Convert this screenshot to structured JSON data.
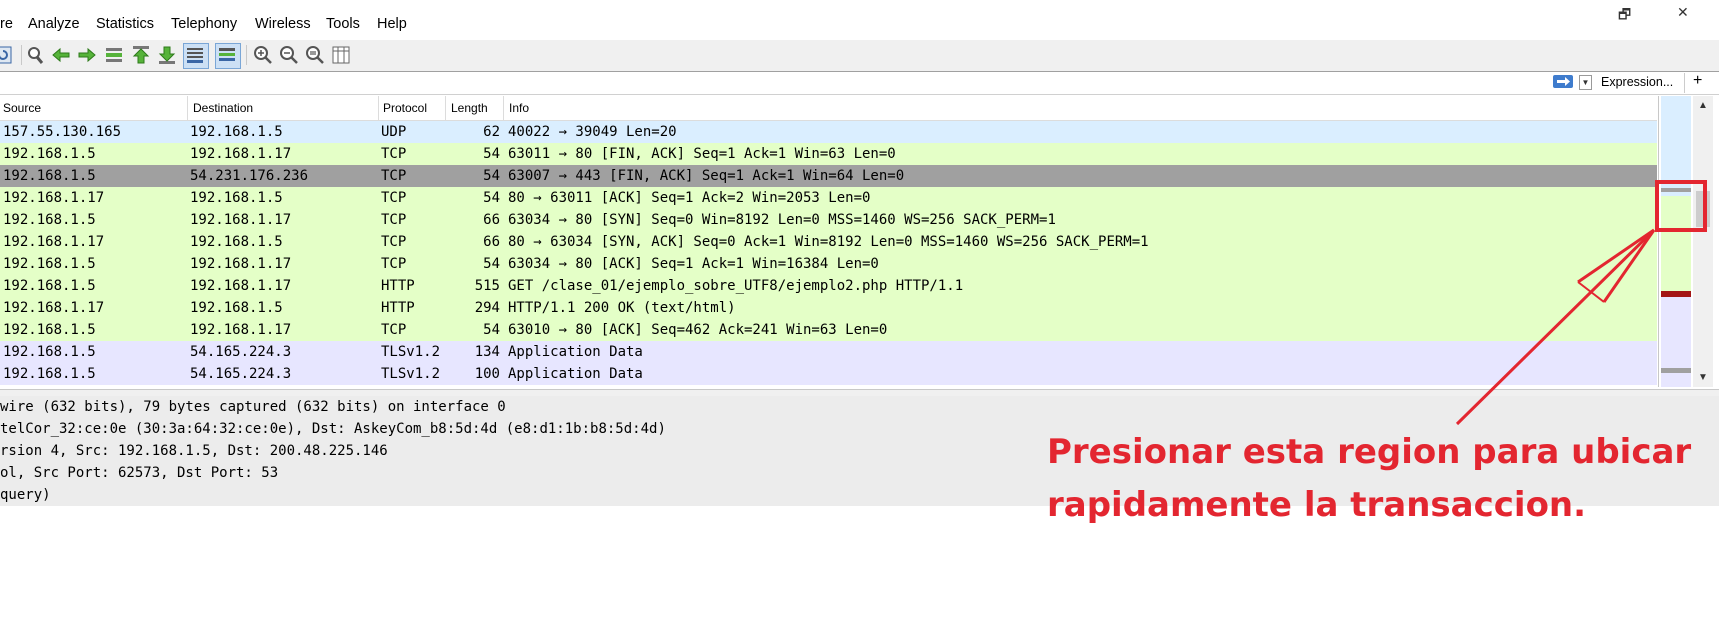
{
  "menu": {
    "items": [
      "re",
      "Analyze",
      "Statistics",
      "Telephony",
      "Wireless",
      "Tools",
      "Help"
    ]
  },
  "window_controls": {
    "restore": "🗗",
    "close": "✕"
  },
  "toolbar": {
    "icons": [
      "reload-icon",
      "find-icon",
      "go-back-icon",
      "go-forward-icon",
      "go-to-packet-icon",
      "first-packet-icon",
      "last-packet-icon",
      "autoscroll-icon",
      "colorize-icon",
      "zoom-in-icon",
      "zoom-out-icon",
      "normal-size-icon",
      "resize-columns-icon"
    ]
  },
  "filter": {
    "expression_label": "Expression...",
    "add_label": "+"
  },
  "packet_list": {
    "columns": {
      "source": "Source",
      "destination": "Destination",
      "protocol": "Protocol",
      "length": "Length",
      "info": "Info"
    },
    "rows": [
      {
        "source": "157.55.130.165",
        "destination": "192.168.1.5",
        "protocol": "UDP",
        "length": "62",
        "info": "40022 → 39049 Len=20",
        "color": "#daeeff"
      },
      {
        "source": "192.168.1.5",
        "destination": "192.168.1.17",
        "protocol": "TCP",
        "length": "54",
        "info": "63011 → 80 [FIN, ACK] Seq=1 Ack=1 Win=63 Len=0",
        "color": "#e4ffc7"
      },
      {
        "source": "192.168.1.5",
        "destination": "54.231.176.236",
        "protocol": "TCP",
        "length": "54",
        "info": "63007 → 443 [FIN, ACK] Seq=1 Ack=1 Win=64 Len=0",
        "color": "#a0a0a0"
      },
      {
        "source": "192.168.1.17",
        "destination": "192.168.1.5",
        "protocol": "TCP",
        "length": "54",
        "info": "80 → 63011 [ACK] Seq=1 Ack=2 Win=2053 Len=0",
        "color": "#e4ffc7"
      },
      {
        "source": "192.168.1.5",
        "destination": "192.168.1.17",
        "protocol": "TCP",
        "length": "66",
        "info": "63034 → 80 [SYN] Seq=0 Win=8192 Len=0 MSS=1460 WS=256 SACK_PERM=1",
        "color": "#e4ffc7"
      },
      {
        "source": "192.168.1.17",
        "destination": "192.168.1.5",
        "protocol": "TCP",
        "length": "66",
        "info": "80 → 63034 [SYN, ACK] Seq=0 Ack=1 Win=8192 Len=0 MSS=1460 WS=256 SACK_PERM=1",
        "color": "#e4ffc7"
      },
      {
        "source": "192.168.1.5",
        "destination": "192.168.1.17",
        "protocol": "TCP",
        "length": "54",
        "info": "63034 → 80 [ACK] Seq=1 Ack=1 Win=16384 Len=0",
        "color": "#e4ffc7"
      },
      {
        "source": "192.168.1.5",
        "destination": "192.168.1.17",
        "protocol": "HTTP",
        "length": "515",
        "info": "GET /clase_01/ejemplo_sobre_UTF8/ejemplo2.php HTTP/1.1",
        "color": "#e4ffc7"
      },
      {
        "source": "192.168.1.17",
        "destination": "192.168.1.5",
        "protocol": "HTTP",
        "length": "294",
        "info": "HTTP/1.1 200 OK  (text/html)",
        "color": "#e4ffc7"
      },
      {
        "source": "192.168.1.5",
        "destination": "192.168.1.17",
        "protocol": "TCP",
        "length": "54",
        "info": "63010 → 80 [ACK] Seq=462 Ack=241 Win=63 Len=0",
        "color": "#e4ffc7"
      },
      {
        "source": "192.168.1.5",
        "destination": "54.165.224.3",
        "protocol": "TLSv1.2",
        "length": "134",
        "info": "Application Data",
        "color": "#e7e6ff"
      },
      {
        "source": "192.168.1.5",
        "destination": "54.165.224.3",
        "protocol": "TLSv1.2",
        "length": "100",
        "info": "Application Data",
        "color": "#e7e6ff"
      }
    ]
  },
  "details": {
    "lines": [
      " wire (632 bits), 79 bytes captured (632 bits) on interface 0",
      "telCor_32:ce:0e (30:3a:64:32:ce:0e), Dst: AskeyCom_b8:5d:4d (e8:d1:1b:b8:5d:4d)",
      "rsion 4, Src: 192.168.1.5, Dst: 200.48.225.146",
      "ol, Src Port: 62573, Dst Port: 53",
      "query)"
    ]
  },
  "annotation": {
    "line1": "Presionar esta region para ubicar",
    "line2": "rapidamente la transaccion.",
    "color": "#e32630"
  }
}
